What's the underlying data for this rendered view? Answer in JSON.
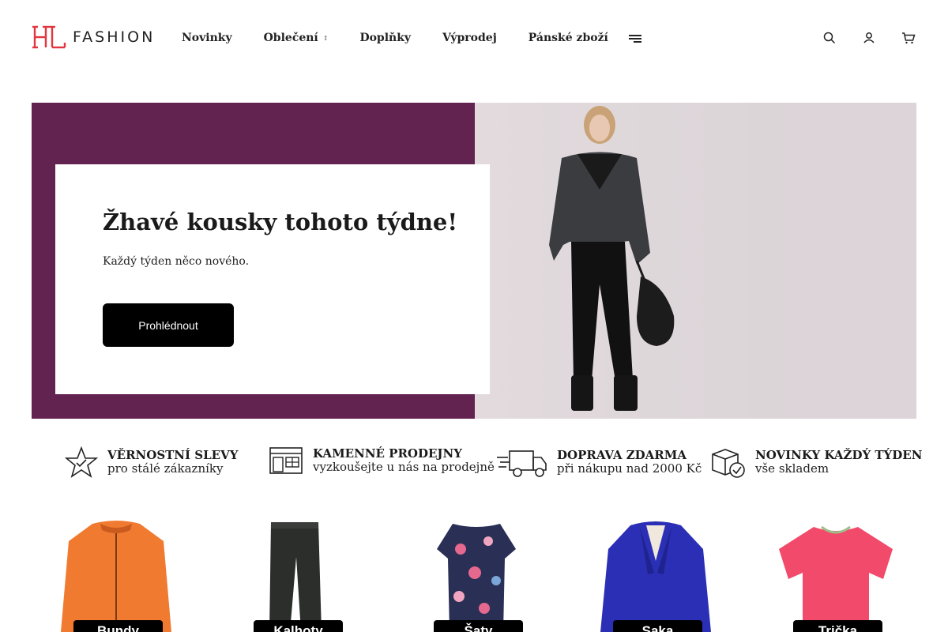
{
  "brand": {
    "logo_text": "FASHION",
    "accent": "#e2353f"
  },
  "nav": {
    "items": [
      {
        "label": "Novinky"
      },
      {
        "label": "Oblečení",
        "has_dropdown": true
      },
      {
        "label": "Doplňky"
      },
      {
        "label": "Výprodej"
      },
      {
        "label": "Pánské zboží"
      }
    ]
  },
  "header_icons": [
    "menu-icon",
    "search-icon",
    "user-icon",
    "cart-icon"
  ],
  "hero": {
    "title": "Žhavé kousky tohoto týdne!",
    "subtitle": "Každý týden něco nového.",
    "button_label": "Prohlédnout",
    "bg_color": "#632351"
  },
  "features": [
    {
      "icon": "star-check-icon",
      "title": "VĚRNOSTNÍ SLEVY",
      "subtitle": "pro stálé zákazníky"
    },
    {
      "icon": "store-icon",
      "title": "KAMENNÉ PRODEJNY",
      "subtitle": "vyzkoušejte u nás na prodejně"
    },
    {
      "icon": "delivery-truck-icon",
      "title": "DOPRAVA ZDARMA",
      "subtitle": "při nákupu nad 2000 Kč"
    },
    {
      "icon": "package-check-icon",
      "title": "NOVINKY KAŽDÝ TÝDEN",
      "subtitle": "vše skladem"
    }
  ],
  "categories": [
    {
      "label": "Bundy",
      "color": "#f07a30"
    },
    {
      "label": "Kalhoty",
      "color": "#2b2e2a"
    },
    {
      "label": "Šaty",
      "color": "#2a2f55"
    },
    {
      "label": "Saka",
      "color": "#2b2fb5"
    },
    {
      "label": "Trička",
      "color": "#f24a6a"
    }
  ]
}
